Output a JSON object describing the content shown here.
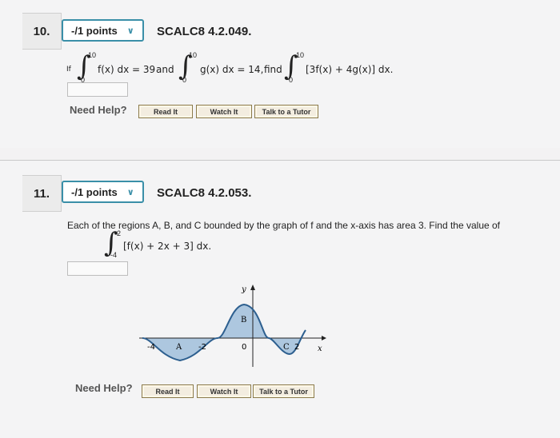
{
  "q10": {
    "number": "10.",
    "points": "-/1 points",
    "code": "SCALC8 4.2.049.",
    "if": "If",
    "int1_upper": "10",
    "int1_lower": "0",
    "int1_body": "f(x) dx = 39",
    "and": "and",
    "int2_upper": "10",
    "int2_lower": "0",
    "int2_body": "g(x) dx = 14,",
    "find": "find",
    "int3_upper": "10",
    "int3_lower": "0",
    "int3_body": "[3f(x) + 4g(x)] dx.",
    "help_label": "Need Help?",
    "read_it": "Read It",
    "watch_it": "Watch It",
    "talk_tutor": "Talk to a Tutor"
  },
  "q11": {
    "number": "11.",
    "points": "-/1 points",
    "code": "SCALC8 4.2.053.",
    "statement": "Each of the regions A, B, and C bounded by the graph of f and the x-axis has area 3. Find the value of",
    "int_upper": "2",
    "int_lower": "-4",
    "int_body": "[f(x) + 2x + 3] dx.",
    "graph": {
      "y_label": "y",
      "x_label": "x",
      "tick_neg4": "-4",
      "tick_neg2": "-2",
      "tick_0": "0",
      "tick_2": "2",
      "region_a": "A",
      "region_b": "B",
      "region_c": "C",
      "curve_color": "#2d5f8f",
      "fill_color": "#8fb4d6"
    },
    "help_label": "Need Help?",
    "read_it": "Read It",
    "watch_it": "Watch It",
    "talk_tutor": "Talk to a Tutor"
  }
}
